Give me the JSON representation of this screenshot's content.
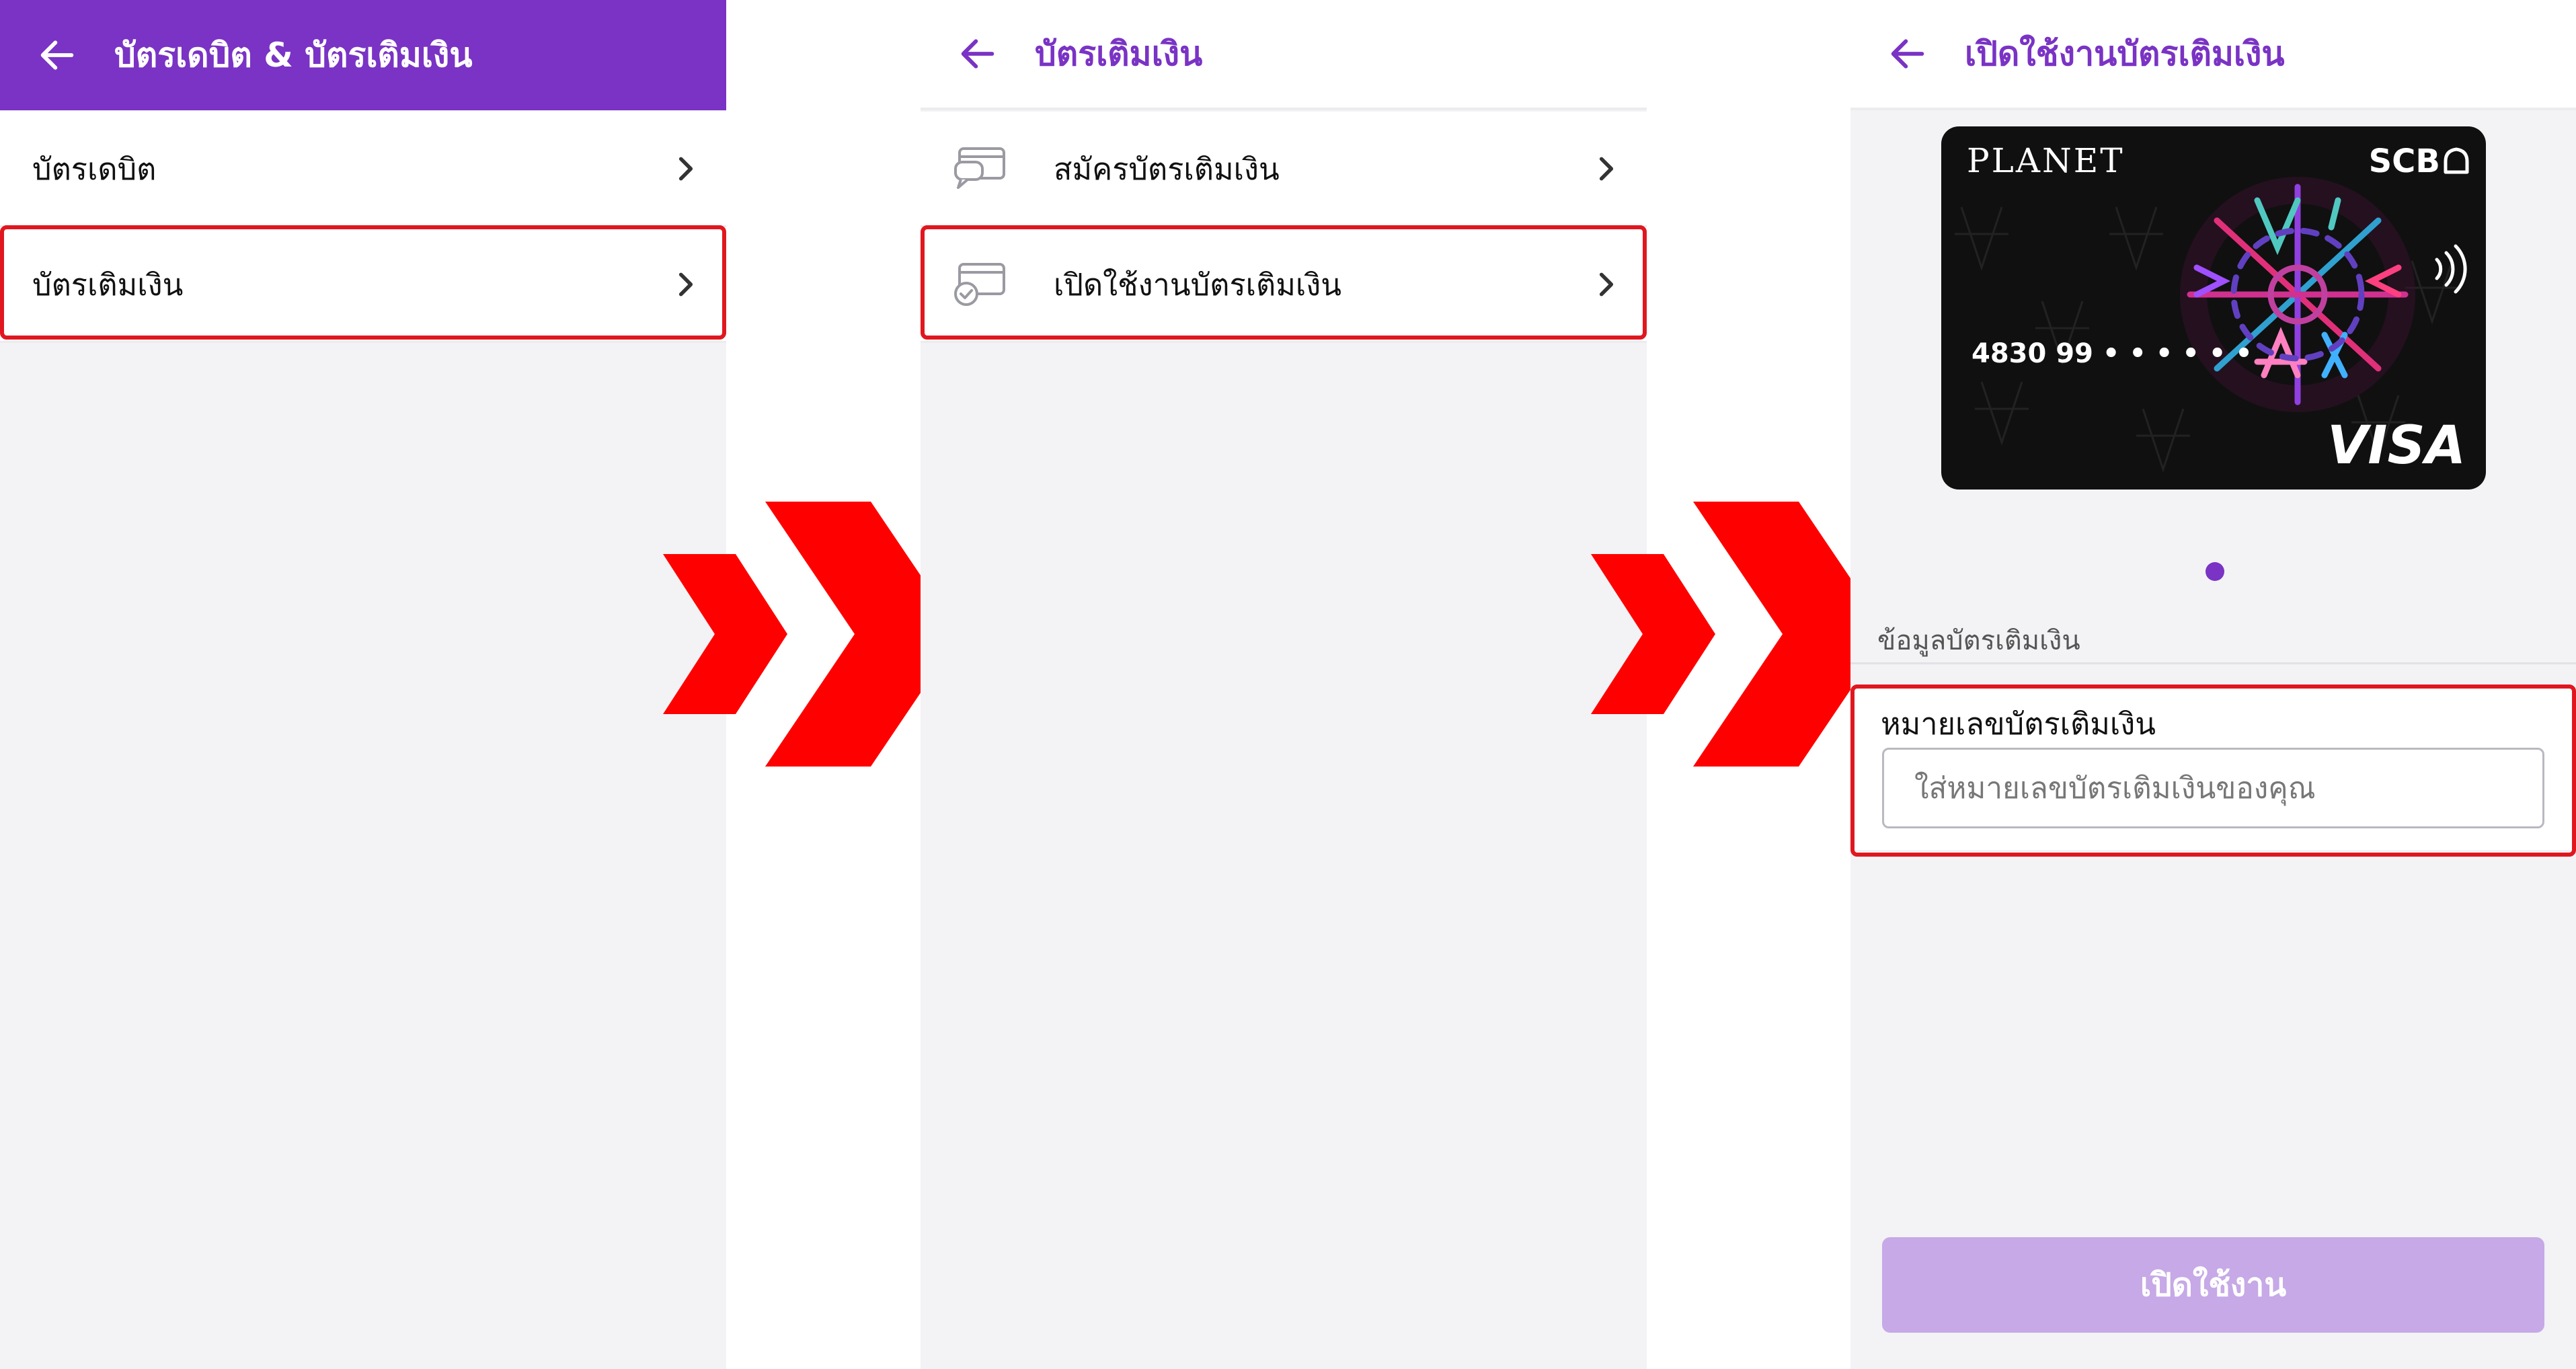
{
  "colors": {
    "brand": "#7a33c4",
    "highlight": "#e0171f",
    "arrow": "#ff0000",
    "button_disabled": "#c6a9e6"
  },
  "screen1": {
    "title": "บัตรเดบิต & บัตรเติมเงิน",
    "items": [
      {
        "label": "บัตรเดบิต",
        "icon": "chevron-right-icon"
      },
      {
        "label": "บัตรเติมเงิน",
        "icon": "chevron-right-icon"
      }
    ]
  },
  "screen2": {
    "title": "บัตรเติมเงิน",
    "items": [
      {
        "label": "สมัครบัตรเติมเงิน",
        "icon": "card-chat-icon"
      },
      {
        "label": "เปิดใช้งานบัตรเติมเงิน",
        "icon": "card-check-icon"
      }
    ]
  },
  "screen3": {
    "title": "เปิดใช้งานบัตรเติมเงิน",
    "card": {
      "brand": "PLANET",
      "bank": "SCB",
      "number": "4830 99 • • • • • •",
      "network": "VISA"
    },
    "section_title": "ข้อมูลบัตรเติมเงิน",
    "field_label": "หมายเลขบัตรเติมเงิน",
    "field_placeholder": "ใส่หมายเลขบัตรเติมเงินของคุณ",
    "field_value": "",
    "submit_label": "เปิดใช้งาน"
  }
}
